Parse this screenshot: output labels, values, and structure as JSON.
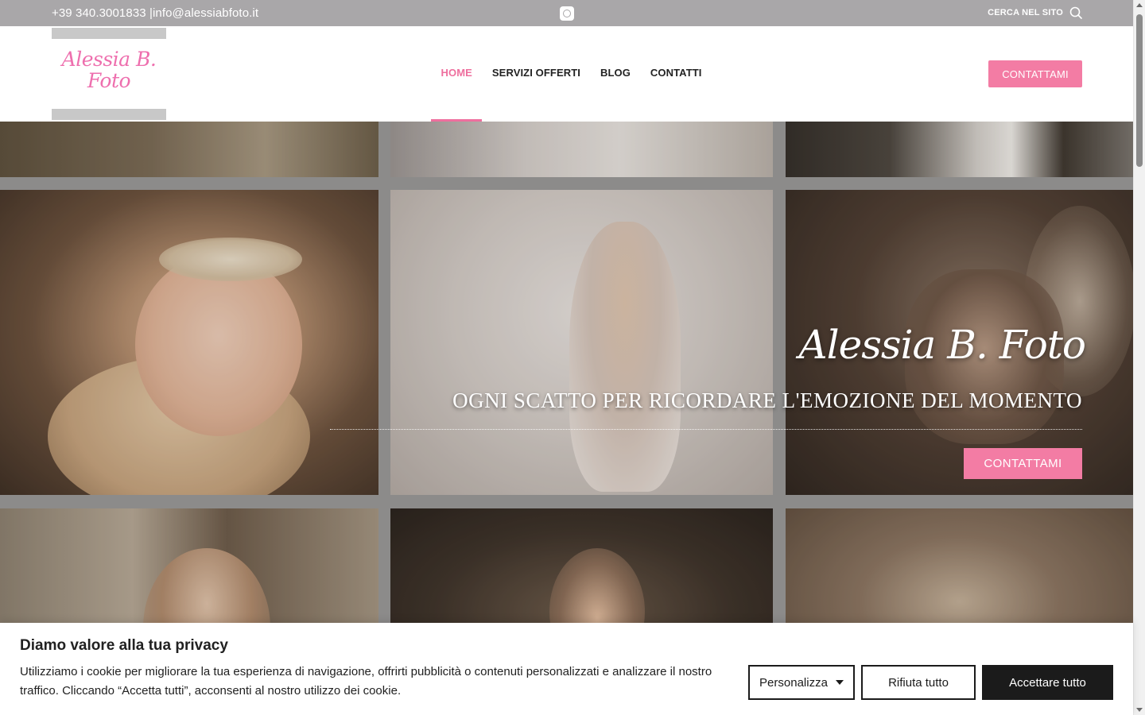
{
  "topbar": {
    "contact_text": "+39 340.3001833 |info@alessiabfoto.it",
    "social_icon": "instagram-icon",
    "search_label": "CERCA NEL SITO",
    "search_icon": "search-icon"
  },
  "header": {
    "logo_line1": "Alessia B.",
    "logo_line2": "Foto",
    "nav": [
      {
        "label": "HOME",
        "active": true
      },
      {
        "label": "SERVIZI OFFERTI",
        "active": false
      },
      {
        "label": "BLOG",
        "active": false
      },
      {
        "label": "CONTATTI",
        "active": false
      }
    ],
    "cta_label": "CONTATTAMI"
  },
  "hero": {
    "title": "Alessia B. Foto",
    "subtitle": "OGNI SCATTO PER RICORDARE L'EMOZIONE DEL MOMENTO",
    "cta_label": "CONTATTAMI"
  },
  "cookie": {
    "title": "Diamo valore alla tua privacy",
    "text": "Utilizziamo i cookie per migliorare la tua esperienza di navigazione, offrirti pubblicità o contenuti personalizzati e analizzare il nostro traffico. Cliccando “Accetta tutti”, acconsenti al nostro utilizzo dei cookie.",
    "customize_label": "Personalizza",
    "reject_label": "Rifiuta tutto",
    "accept_label": "Accettare tutto"
  },
  "colors": {
    "accent": "#f37ca4",
    "nav_active": "#ee6f9e",
    "topbar": "#a9a7a9",
    "dark_button": "#1b1b1b"
  }
}
